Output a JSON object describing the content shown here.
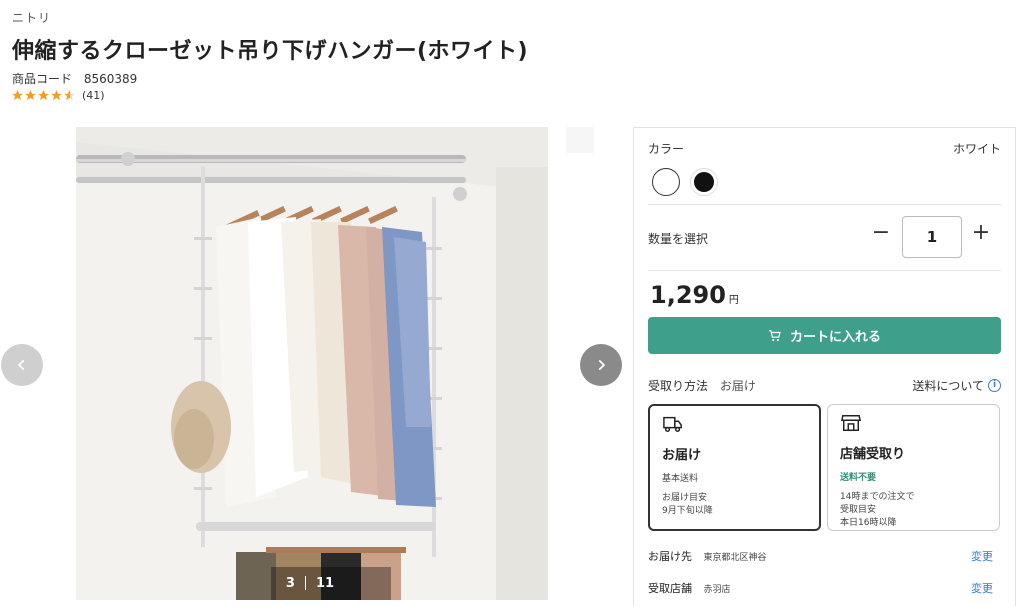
{
  "header": {
    "brand": "ニトリ",
    "title": "伸縮するクローゼット吊り下げハンガー(ホワイト)",
    "code_label": "商品コード",
    "code_value": "8560389",
    "rating": 4.5,
    "review_count": "(41)"
  },
  "gallery": {
    "current": "3",
    "total": "11",
    "prev_icon": "chevron-left-icon",
    "next_icon": "chevron-right-icon"
  },
  "panel": {
    "color_label": "カラー",
    "color_value": "ホワイト",
    "swatches": [
      "white",
      "black"
    ],
    "qty_label": "数量を選択",
    "qty_minus": "−",
    "qty_value": "1",
    "qty_plus": "+",
    "price": "1,290",
    "price_unit": "円",
    "cart_label": "カートに入れる",
    "cart_color": "#3e9f8a",
    "receive_label": "受取り方法",
    "receive_value": "お届け",
    "shipping_link": "送料について",
    "delivery": {
      "title": "お届け",
      "sub": "基本送料",
      "note1": "お届け目安",
      "note2": "9月下旬以降"
    },
    "store": {
      "title": "店舗受取り",
      "sub": "送料不要",
      "note1": "14時までの注文で",
      "note2": "受取目安",
      "note3": "本日16時以降"
    },
    "dest_label": "お届け先",
    "dest_value": "東京都北区神谷",
    "store_label": "受取店舗",
    "store_value": "赤羽店",
    "change_label": "変更"
  }
}
